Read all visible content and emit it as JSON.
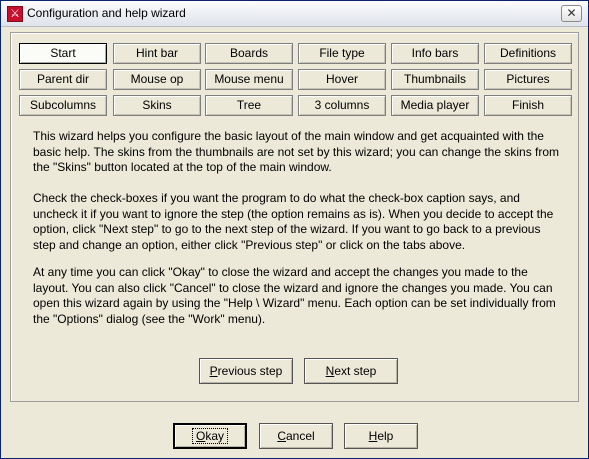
{
  "window": {
    "title": "Configuration and help wizard",
    "close_glyph": "✕",
    "app_icon_glyph": "⚔"
  },
  "tabs": [
    {
      "label": "Start",
      "active": true
    },
    {
      "label": "Hint bar"
    },
    {
      "label": "Boards"
    },
    {
      "label": "File type"
    },
    {
      "label": "Info bars"
    },
    {
      "label": "Definitions"
    },
    {
      "label": "Parent dir"
    },
    {
      "label": "Mouse op"
    },
    {
      "label": "Mouse menu"
    },
    {
      "label": "Hover"
    },
    {
      "label": "Thumbnails"
    },
    {
      "label": "Pictures"
    },
    {
      "label": "Subcolumns"
    },
    {
      "label": "Skins"
    },
    {
      "label": "Tree"
    },
    {
      "label": "3 columns"
    },
    {
      "label": "Media player"
    },
    {
      "label": "Finish"
    }
  ],
  "paragraphs": [
    "This wizard helps you configure the basic layout of the main window and get acquainted with the basic help. The skins from the thumbnails are not set by this wizard; you can change the skins from the \"Skins\" button located at the top of the main window.",
    "Check the check-boxes if you want the program to do what the check-box caption says, and uncheck it if you want to ignore the step (the option remains as is). When you decide to accept the option, click \"Next step\" to go to the next step of the wizard. If you want to go back to a previous step and change an option, either click \"Previous step\" or click on the tabs above.",
    "At any time you can click \"Okay\" to close the wizard and accept the changes you made to the layout. You can also click \"Cancel\" to close the wizard and ignore the changes you made. You can open this wizard again by using the \"Help \\ Wizard\" menu. Each option can be set individually from the \"Options\" dialog (see the \"Work\" menu)."
  ],
  "nav": {
    "previous": {
      "accel": "P",
      "rest": "revious step"
    },
    "next": {
      "accel": "N",
      "rest": "ext step"
    }
  },
  "footer": {
    "okay": {
      "accel": "O",
      "rest": "kay"
    },
    "cancel": {
      "accel": "C",
      "rest": "ancel"
    },
    "help": {
      "accel": "H",
      "rest": "elp"
    }
  }
}
